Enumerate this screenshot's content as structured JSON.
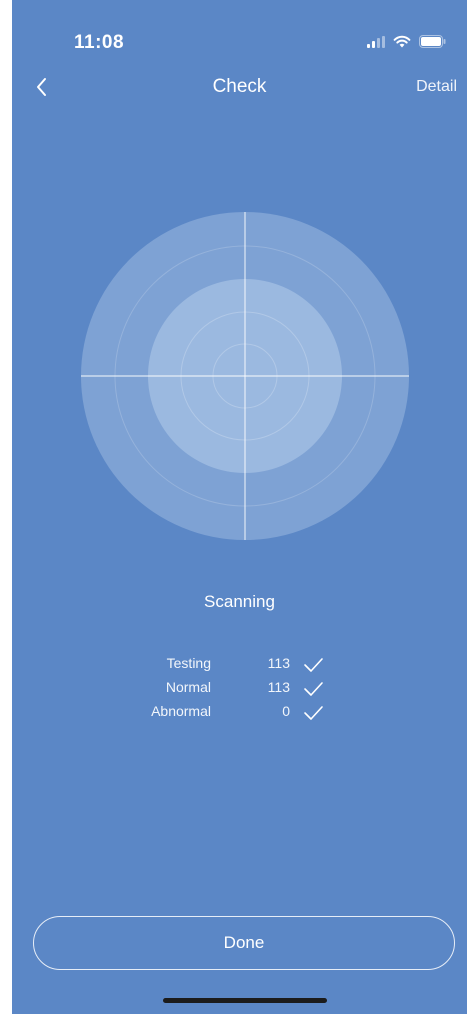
{
  "status_bar": {
    "time": "11:08"
  },
  "nav": {
    "back_icon": "chevron-left-icon",
    "title": "Check",
    "detail_label": "Detail"
  },
  "radar": {
    "icon": "radar-scan"
  },
  "scan": {
    "status": "Scanning",
    "rows": [
      {
        "label": "Testing",
        "value": "113"
      },
      {
        "label": "Normal",
        "value": "113"
      },
      {
        "label": "Abnormal",
        "value": "0"
      }
    ]
  },
  "footer": {
    "done_label": "Done"
  },
  "colors": {
    "background": "#5b87c6",
    "radar_outer": "#7ea2d4",
    "radar_inner": "#9bb9e0"
  }
}
